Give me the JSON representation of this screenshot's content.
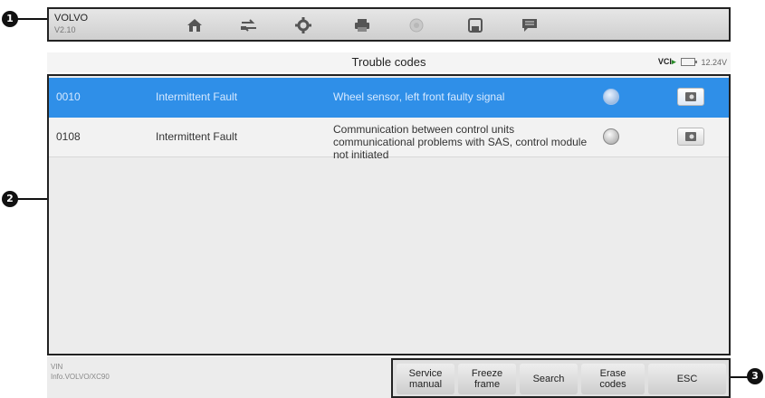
{
  "callouts": [
    "1",
    "2",
    "3"
  ],
  "header": {
    "make": "VOLVO",
    "version": "V2.10",
    "toolbar_icons": [
      "home-icon",
      "vehicle-swap-icon",
      "settings-icon",
      "print-icon",
      "record-icon",
      "save-icon",
      "message-icon"
    ]
  },
  "titlebar": {
    "title": "Trouble codes",
    "vci_label": "VCI",
    "voltage": "12.24V"
  },
  "dtc_rows": [
    {
      "code": "0010",
      "status": "Intermittent Fault",
      "description": "Wheel sensor, left front faulty signal",
      "selected": true
    },
    {
      "code": "0108",
      "status": "Intermittent Fault",
      "description": "Communication between control units communicational problems with SAS, control module not initiated",
      "selected": false
    }
  ],
  "footer": {
    "vin_label": "VIN",
    "vehicle_path": "Info.VOLVO/XC90",
    "buttons": [
      "Service\nmanual",
      "Freeze\nframe",
      "Search",
      "Erase\ncodes",
      "ESC"
    ]
  },
  "colors": {
    "selected_row": "#2f8fe8",
    "vci_green": "#2a8c2a"
  }
}
